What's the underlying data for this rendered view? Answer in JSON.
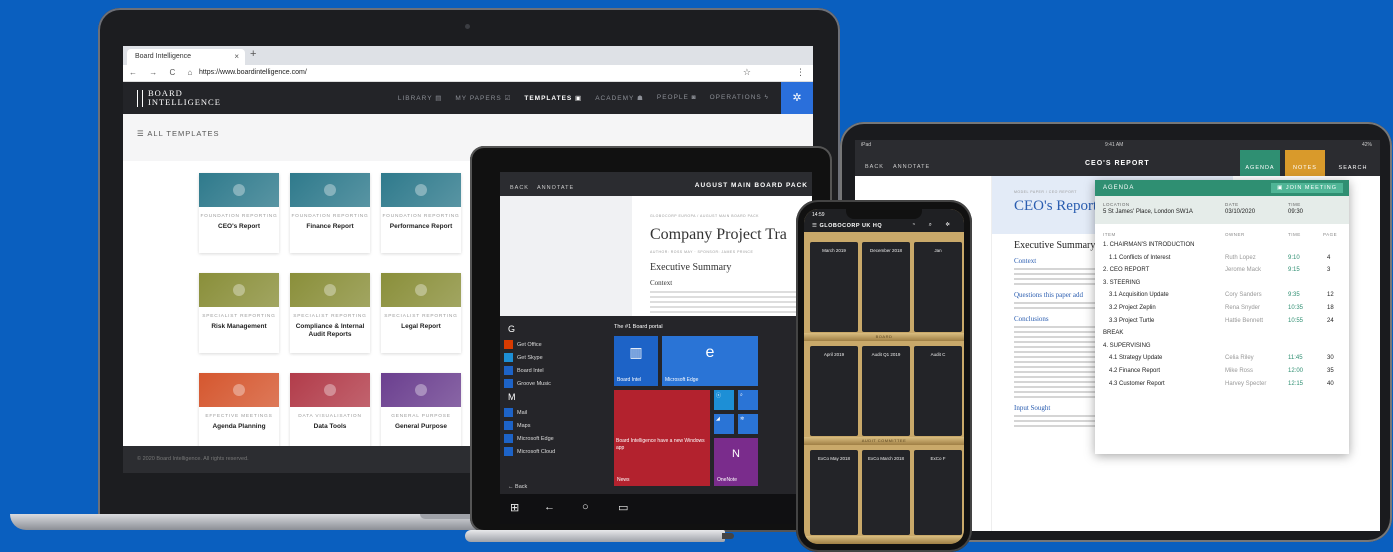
{
  "laptop": {
    "tab_title": "Board Intelligence",
    "tab_close": "×",
    "tab_new": "+",
    "nav_buttons": "← → C ⌂",
    "url": "https://www.boardintelligence.com/",
    "star": "☆",
    "menu": "⋮",
    "logo_line1": "BOARD",
    "logo_line2": "INTELLIGENCE",
    "nav": [
      {
        "label": "LIBRARY ▤"
      },
      {
        "label": "MY PAPERS ☑"
      },
      {
        "label": "TEMPLATES ▣"
      },
      {
        "label": "ACADEMY ☗"
      },
      {
        "label": "PEOPLE ◙"
      },
      {
        "label": "OPERATIONS ϟ"
      }
    ],
    "gear": "✲",
    "templates_title": "☰ ALL TEMPLATES",
    "footer": "© 2020 Board Intelligence. All rights reserved.",
    "tiles": [
      {
        "category": "FOUNDATION REPORTING",
        "name": "CEO's Report",
        "color": "#2f7a8c"
      },
      {
        "category": "FOUNDATION REPORTING",
        "name": "Finance Report",
        "color": "#2f7a8c"
      },
      {
        "category": "FOUNDATION REPORTING",
        "name": "Performance Report",
        "color": "#2f7a8c"
      },
      {
        "category": "SPECIALIST REPORTING",
        "name": "Risk Management",
        "color": "#8a8f3a"
      },
      {
        "category": "SPECIALIST REPORTING",
        "name": "Compliance & Internal Audit Reports",
        "color": "#8a8f3a"
      },
      {
        "category": "SPECIALIST REPORTING",
        "name": "Legal Report",
        "color": "#8a8f3a"
      },
      {
        "category": "EFFECTIVE MEETINGS",
        "name": "Agenda Planning",
        "color": "#d5572f"
      },
      {
        "category": "DATA VISUALISATION",
        "name": "Data Tools",
        "color": "#b23c4a"
      },
      {
        "category": "GENERAL PURPOSE",
        "name": "General Purpose",
        "color": "#6b3f8f"
      }
    ]
  },
  "tablet": {
    "back": "BACK",
    "annotate": "ANNOTATE",
    "title": "AUGUST MAIN BOARD PACK",
    "doc_meta": "GLOBOCORP EUROPA / AUGUST MAIN BOARD PACK",
    "doc_title": "Company Project Tra",
    "doc_authors": "AUTHOR: ROSS MAY  ·  SPONSOR: JAMES PRINCE",
    "doc_h2": "Executive Summary",
    "doc_h3": "Context",
    "start_letter_g": "G",
    "start_letter_m": "M",
    "start_items": [
      {
        "label": "Get Office",
        "color": "#d83b01"
      },
      {
        "label": "Get Skype",
        "color": "#1d8fd6"
      },
      {
        "label": "Board Intel",
        "color": "#1d63c7"
      },
      {
        "label": "Groove Music",
        "color": "#1d63c7"
      },
      {
        "label": "Mail",
        "color": "#1d63c7"
      },
      {
        "label": "Maps",
        "color": "#1d63c7"
      },
      {
        "label": "Microsoft Edge",
        "color": "#1d63c7"
      },
      {
        "label": "Microsoft Cloud",
        "color": "#1d63c7"
      }
    ],
    "tiles_title": "The #1 Board portal",
    "tile_board": "Board Intel",
    "tile_edge": "Microsoft Edge",
    "tile_news": "Board Intelligence have a new Windows app",
    "tile_news_label": "News",
    "tile_onenote": "OneNote",
    "back_link": "← Back"
  },
  "ipad": {
    "status_left": "iPad",
    "status_time": "9:41 AM",
    "status_right": "42%",
    "back": "BACK",
    "annotate": "ANNOTATE",
    "title": "CEO'S REPORT",
    "agenda_btn": "AGENDA",
    "notes_btn": "NOTES",
    "search_btn": "SEARCH",
    "doc_meta": "MODEL PAPER / CEO REPORT",
    "doc_title": "CEO's Report",
    "doc_h2": "Executive Summary",
    "doc_h3a": "Context",
    "doc_h3b": "Questions this paper add",
    "doc_h3c": "Conclusions",
    "doc_h3d": "Input Sought",
    "agenda": {
      "title": "AGENDA",
      "join": "▣ JOIN MEETING",
      "location_label": "LOCATION",
      "location": "5 St James' Place, London SW1A",
      "date_label": "DATE",
      "date": "03/10/2020",
      "time_label": "TIME",
      "time": "09:30",
      "col_item": "ITEM",
      "col_owner": "OWNER",
      "col_time": "TIME",
      "col_page": "PAGE",
      "rows": [
        {
          "item": "1. CHAIRMAN'S INTRODUCTION",
          "owner": "",
          "time": "",
          "page": "",
          "indent": 0
        },
        {
          "item": "1.1 Conflicts of Interest",
          "owner": "Ruth Lopez",
          "time": "9:10",
          "page": "4",
          "indent": 1
        },
        {
          "item": "2. CEO REPORT",
          "owner": "Jerome Mack",
          "time": "9:15",
          "page": "3",
          "indent": 0
        },
        {
          "item": "3. STEERING",
          "owner": "",
          "time": "",
          "page": "",
          "indent": 0
        },
        {
          "item": "3.1 Acquisition Update",
          "owner": "Cory Sanders",
          "time": "9:35",
          "page": "12",
          "indent": 1
        },
        {
          "item": "3.2 Project Zeplin",
          "owner": "Rena Snyder",
          "time": "10:35",
          "page": "18",
          "indent": 1
        },
        {
          "item": "3.3 Project Turtle",
          "owner": "Hattie Bennett",
          "time": "10:55",
          "page": "24",
          "indent": 1
        },
        {
          "item": "BREAK",
          "owner": "",
          "time": "",
          "page": "",
          "indent": 0
        },
        {
          "item": "4. SUPERVISING",
          "owner": "",
          "time": "",
          "page": "",
          "indent": 0
        },
        {
          "item": "4.1 Strategy Update",
          "owner": "Celia Riley",
          "time": "11:45",
          "page": "30",
          "indent": 1
        },
        {
          "item": "4.2 Finance Report",
          "owner": "Mike Ross",
          "time": "12:00",
          "page": "35",
          "indent": 1
        },
        {
          "item": "4.3 Customer Report",
          "owner": "Harvey Specter",
          "time": "12:15",
          "page": "40",
          "indent": 1
        }
      ]
    }
  },
  "phone": {
    "time": "14:59",
    "title": "☰  GLOBOCORP UK HQ",
    "icons": "◔ ⌕ ✲",
    "shelf_board": "BOARD",
    "shelf_audit": "AUDIT COMMITTEE",
    "books_top": [
      "March 2019",
      "December 2018",
      "Jan"
    ],
    "books_mid": [
      "April 2019",
      "Audit Q1 2019",
      "Audit C"
    ],
    "books_bottom": [
      "ExCo May 2018",
      "ExCo March 2018",
      "ExCo F"
    ]
  }
}
